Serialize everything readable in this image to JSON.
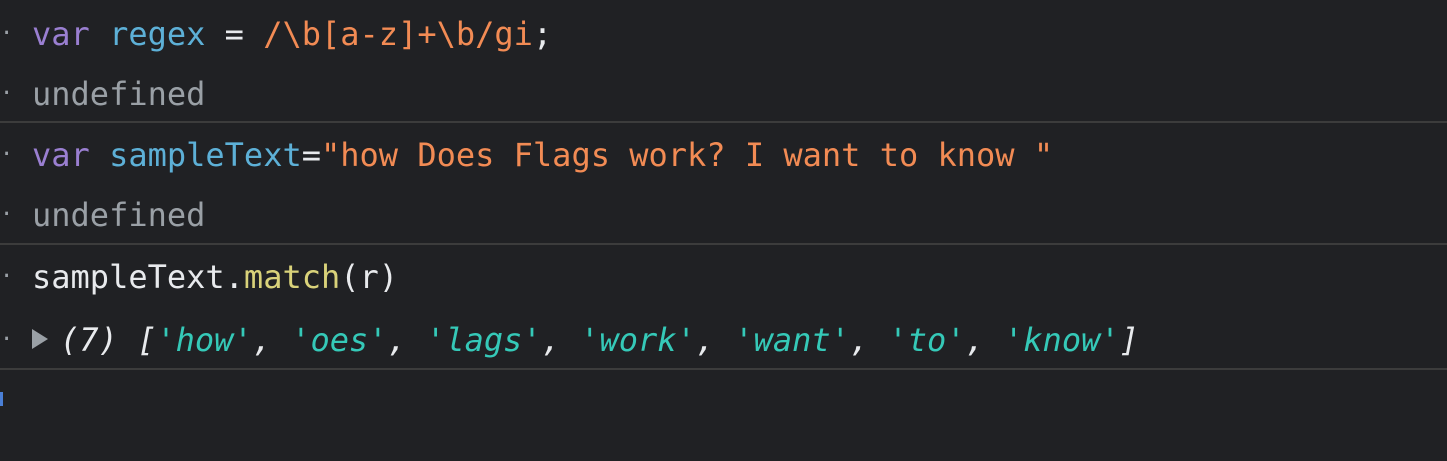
{
  "entries": [
    {
      "input": {
        "kw": "var",
        "name": "regex",
        "op": " = ",
        "value": "/\\b[a-z]+\\b/gi",
        "end": ";"
      },
      "output": "undefined"
    },
    {
      "input": {
        "kw": "var",
        "name": "sampleText",
        "op": "=",
        "value": "\"how Does Flags work? I want to know \""
      },
      "output": "undefined"
    },
    {
      "input": {
        "object": "sampleText",
        "dot": ".",
        "method": "match",
        "args": "(r)"
      },
      "result": {
        "count": "(7)",
        "open": "[",
        "items": [
          "'how'",
          "'oes'",
          "'lags'",
          "'work'",
          "'want'",
          "'to'",
          "'know'"
        ],
        "separator": ", ",
        "close": "]"
      }
    }
  ],
  "colors": {
    "background": "#202124",
    "keyword": "#9a7fd1",
    "variable": "#5db0d7",
    "string": "#f28b54",
    "function": "#d9d27a",
    "array_item": "#35c9b8",
    "muted": "#9aa0a6"
  },
  "icons": {
    "expand": "triangle-right-icon",
    "prompt_marker": "dot-icon"
  }
}
